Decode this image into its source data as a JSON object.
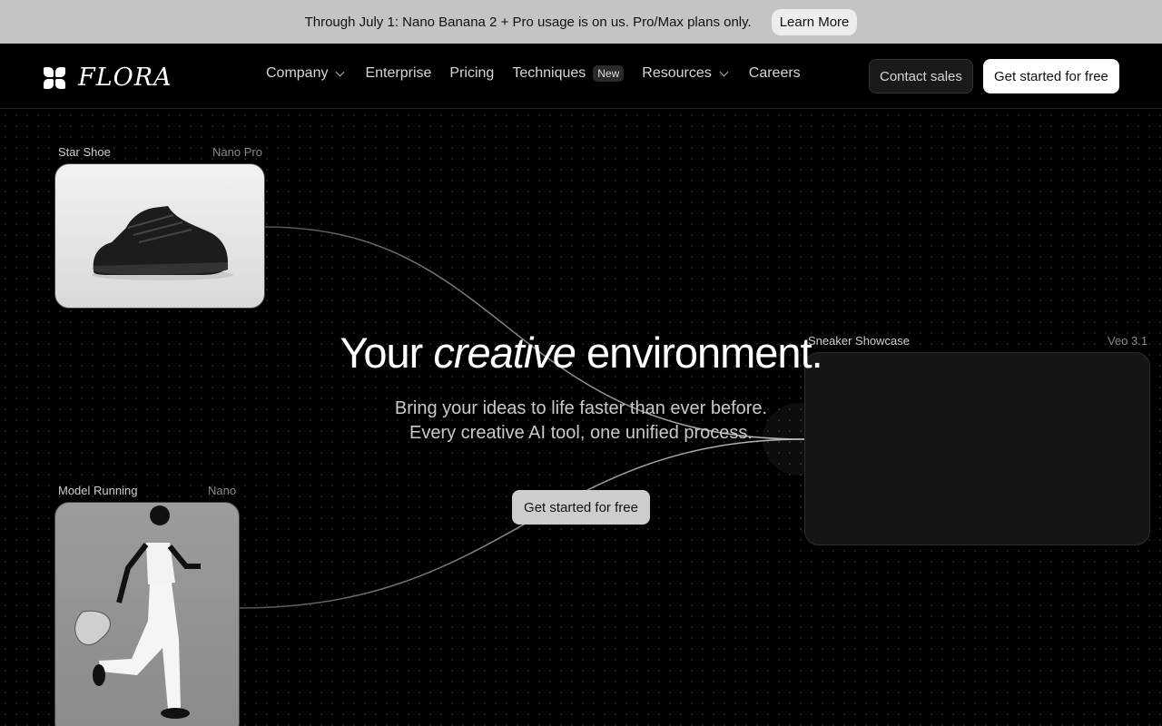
{
  "announcement": {
    "text": "Through July 1: Nano Banana 2 + Pro usage is on us. Pro/Max plans only.",
    "button": "Learn More"
  },
  "nav": {
    "logo": "FLORA",
    "items": [
      {
        "label": "Company",
        "dropdown": true
      },
      {
        "label": "Enterprise"
      },
      {
        "label": "Pricing"
      },
      {
        "label": "Techniques",
        "badge": "New"
      },
      {
        "label": "Resources",
        "dropdown": true
      },
      {
        "label": "Careers"
      }
    ],
    "contact": "Contact sales",
    "cta": "Get started for free"
  },
  "hero": {
    "title_before": "Your",
    "title_italic": "creative",
    "title_after": "environment.",
    "sub_line1": "Bring your ideas to life faster than ever before.",
    "sub_line2": "Every creative AI tool, one unified process.",
    "cta": "Get started for free"
  },
  "nodes": {
    "shoe": {
      "title": "Star Shoe",
      "model": "Nano Pro"
    },
    "model": {
      "title": "Model Running",
      "model": "Nano"
    },
    "video": {
      "title": "Sneaker Showcase",
      "model": "Veo 3.1"
    }
  },
  "colors": {
    "announce_bg": "#c4c4c4",
    "page_bg": "#000000",
    "cta_bg": "#ffffff"
  }
}
